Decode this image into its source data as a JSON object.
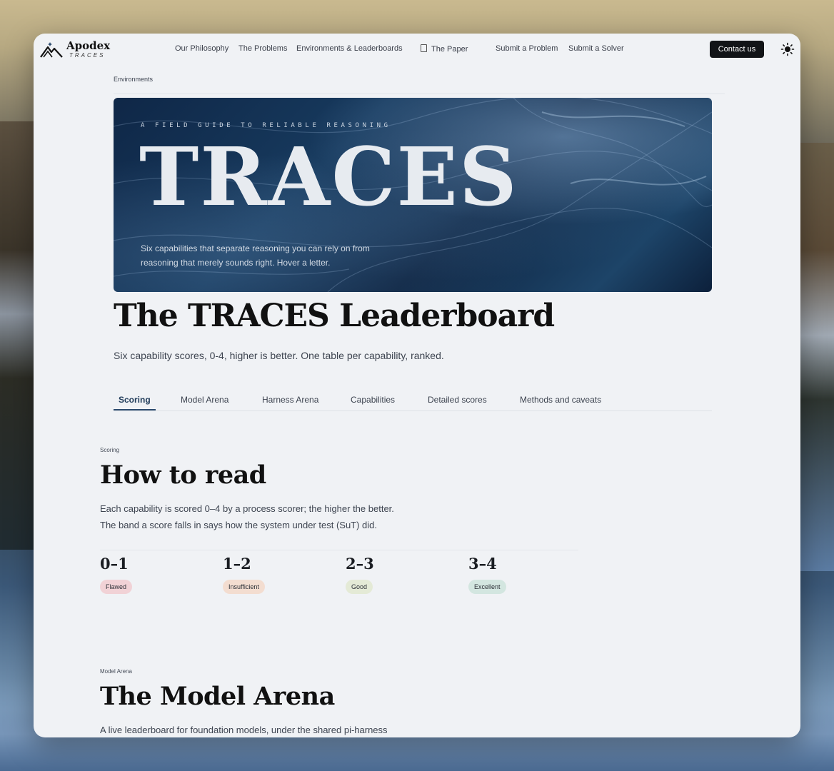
{
  "nav": {
    "brand_name": "Apodex",
    "brand_sub": "TRACES",
    "links": [
      "Our Philosophy",
      "The Problems",
      "Environments & Leaderboards",
      "The Paper",
      "Submit a Problem",
      "Submit a Solver"
    ],
    "contact": "Contact us",
    "theme_icon": "sun-icon"
  },
  "breadcrumb": "Environments",
  "hero": {
    "kicker": "A FIELD GUIDE TO RELIABLE REASONING",
    "title": "TRACES",
    "subtitle": "Six capabilities that separate reasoning you can rely on from reasoning that merely sounds right. Hover a letter."
  },
  "page": {
    "title": "The TRACES Leaderboard",
    "subtitle": "Six capability scores, 0-4, higher is better. One table per capability, ranked."
  },
  "tabs": [
    "Scoring",
    "Model Arena",
    "Harness Arena",
    "Capabilities",
    "Detailed scores",
    "Methods and caveats"
  ],
  "scoring": {
    "label": "Scoring",
    "title": "How to read",
    "body1": "Each capability is scored 0–4 by a process scorer; the higher the better.",
    "body2": "The band a score falls in says how the system under test (SuT) did.",
    "bands": [
      {
        "range": "0–1",
        "label": "Flawed",
        "color": "#f1d2d6"
      },
      {
        "range": "1–2",
        "label": "Insufficient",
        "color": "#f3ddd0"
      },
      {
        "range": "2–3",
        "label": "Good",
        "color": "#e4ead6"
      },
      {
        "range": "3–4",
        "label": "Excellent",
        "color": "#d3e6e0"
      }
    ]
  },
  "model_arena": {
    "label": "Model Arena",
    "title": "The Model Arena",
    "body": "A live leaderboard for foundation models, under the shared pi-harness"
  }
}
